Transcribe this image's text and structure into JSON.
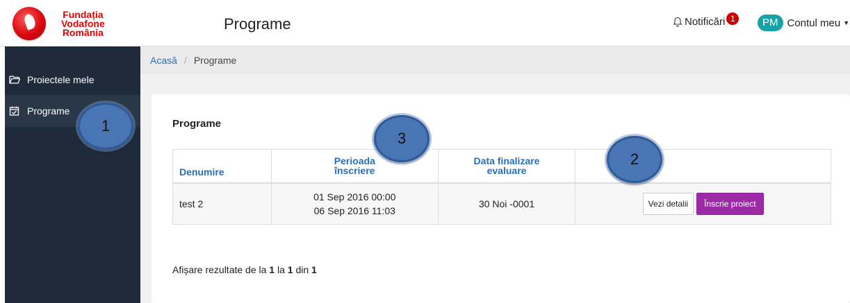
{
  "brand": {
    "line1": "Fundația",
    "line2": "Vodafone",
    "line3": "România",
    "color": "#e60000"
  },
  "header": {
    "title": "Programe",
    "notifications_label": "Notificări",
    "notifications_count": "1",
    "avatar_initials": "PM",
    "account_label": "Contul meu"
  },
  "sidebar": {
    "items": [
      {
        "label": "Proiectele mele",
        "icon": "folder-open-icon"
      },
      {
        "label": "Programe",
        "icon": "calendar-check-icon"
      }
    ]
  },
  "breadcrumb": {
    "home": "Acasă",
    "separator": "/",
    "current": "Programe"
  },
  "main": {
    "section_title": "Programe",
    "columns": {
      "name": "Denumire",
      "period_line1": "Perioada",
      "period_line2": "înscriere",
      "eval_line1": "Data finalizare",
      "eval_line2": "evaluare"
    },
    "rows": [
      {
        "name": "test 2",
        "period_start": "01 Sep 2016 00:00",
        "period_end": "06 Sep 2016 11:03",
        "eval_date": "30 Noi -0001",
        "details_label": "Vezi detalii",
        "enroll_label": "Înscrie proiect"
      }
    ],
    "results": {
      "prefix": "Afișare rezultate de la",
      "from": "1",
      "to_word": "la",
      "to": "1",
      "of_word": "din",
      "total": "1"
    }
  },
  "callouts": [
    "1",
    "2",
    "3"
  ],
  "colors": {
    "sidebar_bg": "#1f2b3a",
    "link": "#2a6eb5",
    "enroll_button": "#9c2aa5",
    "avatar": "#17a3a5",
    "badge": "#cc0000"
  }
}
